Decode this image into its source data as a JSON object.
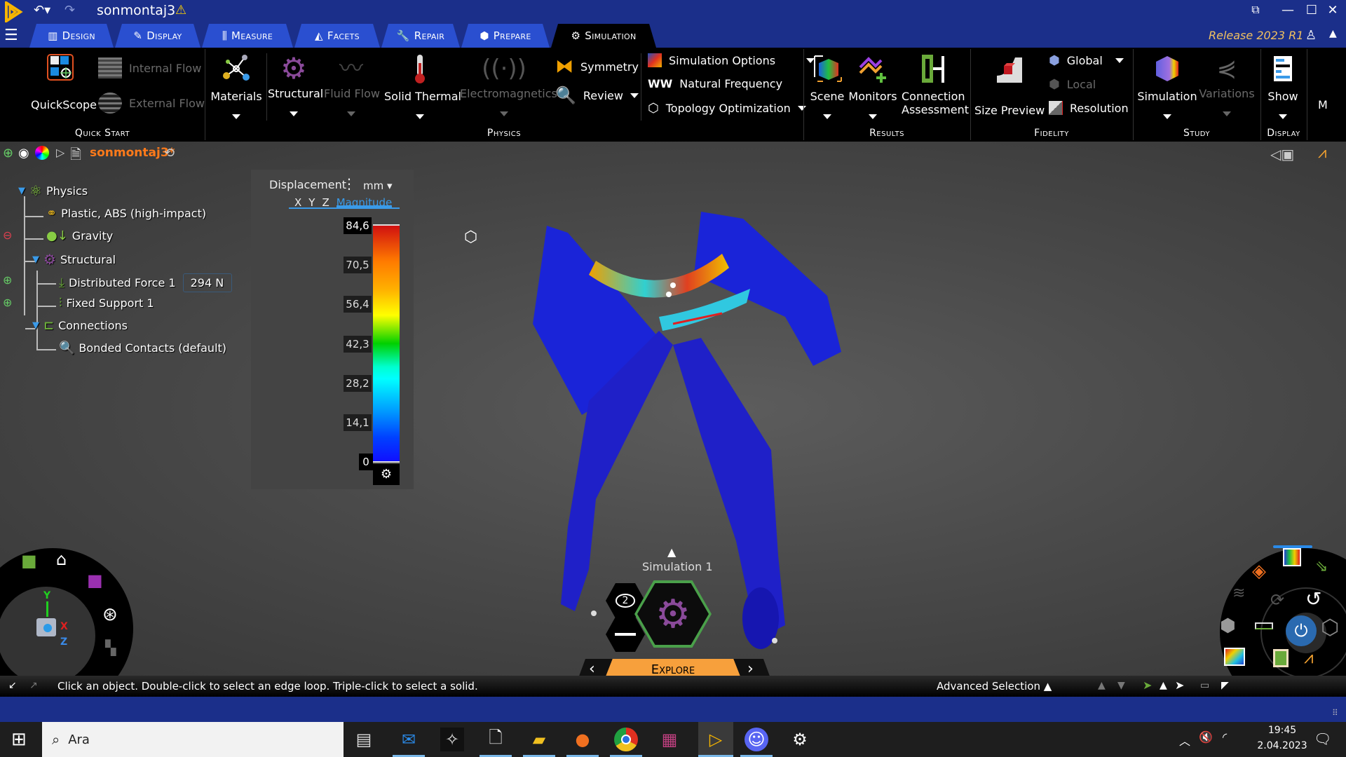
{
  "app": {
    "title": "sonmontaj3",
    "release": "Release 2023 R1"
  },
  "tabs": [
    {
      "label": "Design",
      "icon": "design-icon"
    },
    {
      "label": "Display",
      "icon": "brush-icon"
    },
    {
      "label": "Measure",
      "icon": "measure-icon"
    },
    {
      "label": "Facets",
      "icon": "facets-icon"
    },
    {
      "label": "Repair",
      "icon": "wrench-icon"
    },
    {
      "label": "Prepare",
      "icon": "prepare-icon"
    },
    {
      "label": "Simulation",
      "icon": "simulation-icon",
      "active": true
    }
  ],
  "ribbon": {
    "quickstart": {
      "label": "Quick Start",
      "quickscope": "QuickScope",
      "internal_flow": "Internal Flow",
      "external_flow": "External Flow"
    },
    "physics": {
      "label": "Physics",
      "materials": "Materials",
      "structural": "Structural",
      "fluid_flow": "Fluid Flow",
      "solid_thermal": "Solid Thermal",
      "electromagnetics": "Electromagnetics",
      "symmetry": "Symmetry",
      "review": "Review",
      "simulation_options": "Simulation Options",
      "natural_frequency": "Natural Frequency",
      "topology_optimization": "Topology Optimization"
    },
    "results": {
      "label": "Results",
      "scene": "Scene",
      "monitors": "Monitors",
      "connection_assessment_1": "Connection",
      "connection_assessment_2": "Assessment"
    },
    "fidelity": {
      "label": "Fidelity",
      "size_preview": "Size Preview",
      "global": "Global",
      "local": "Local",
      "resolution": "Resolution"
    },
    "study": {
      "label": "Study",
      "simulation": "Simulation",
      "variations": "Variations"
    },
    "display": {
      "label": "Display",
      "show": "Show",
      "more": "M"
    }
  },
  "tree": {
    "root": "sonmontaj3*",
    "items": [
      {
        "label": "Physics"
      },
      {
        "label": "Plastic, ABS (high-impact)"
      },
      {
        "label": "Gravity"
      },
      {
        "label": "Structural"
      },
      {
        "label": "Distributed Force 1",
        "value": "294 N"
      },
      {
        "label": "Fixed Support 1"
      },
      {
        "label": "Connections"
      },
      {
        "label": "Bonded Contacts (default)"
      }
    ]
  },
  "legend": {
    "title": "Displacement",
    "unit": "mm",
    "components": [
      "X",
      "Y",
      "Z",
      "Magnitude"
    ],
    "active_component": "Magnitude",
    "ticks": [
      "84,6",
      "70,5",
      "56,4",
      "42,3",
      "28,2",
      "14,1",
      "0"
    ],
    "max": 84.6,
    "min": 0
  },
  "study_hud": {
    "name": "Simulation 1",
    "messages_count": "2",
    "mode": "Explore"
  },
  "triad": {
    "x": "X",
    "y": "Y",
    "z": "Z"
  },
  "statusbar": {
    "hint": "Click an object. Double-click to select an edge loop. Triple-click to select a solid.",
    "advanced_selection": "Advanced Selection"
  },
  "taskbar": {
    "search_placeholder": "Ara",
    "time": "19:45",
    "date": "2.04.2023"
  },
  "colors": {
    "title_blue": "#1b2f8a",
    "tab_blue": "#2a4fd0",
    "accent_orange": "#f7a03c",
    "tree_root_orange": "#ff7a1a",
    "legend_active_blue": "#3a9ae8"
  }
}
